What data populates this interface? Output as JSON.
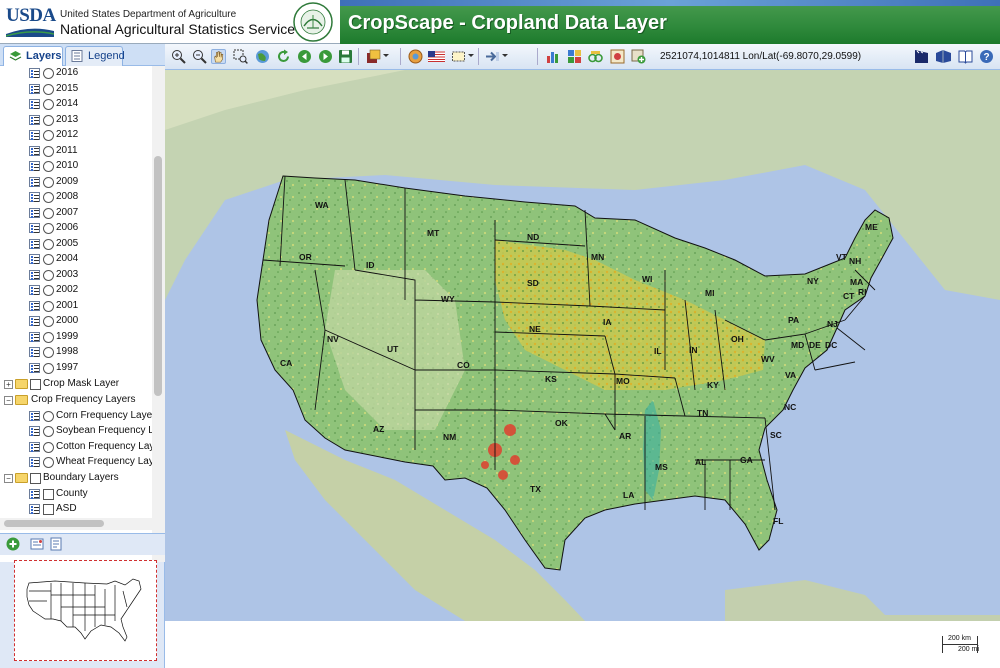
{
  "header": {
    "logo_text": "USDA",
    "department": "United States Department of Agriculture",
    "agency": "National Agricultural Statistics Service",
    "seal_text": "AGRICULTURE COUNTS",
    "app_title": "CropScape - Cropland Data Layer"
  },
  "panel": {
    "tabs": [
      {
        "label": "Layers",
        "active": true,
        "icon": "layers-icon"
      },
      {
        "label": "Legend",
        "active": false,
        "icon": "legend-icon"
      }
    ],
    "years": [
      "2016",
      "2015",
      "2014",
      "2013",
      "2012",
      "2011",
      "2010",
      "2009",
      "2008",
      "2007",
      "2006",
      "2005",
      "2004",
      "2003",
      "2002",
      "2001",
      "2000",
      "1999",
      "1998",
      "1997"
    ],
    "crop_mask": "Crop Mask Layer",
    "crop_frequency": {
      "label": "Crop Frequency Layers",
      "items": [
        "Corn Frequency Layer (",
        "Soybean Frequency Lay",
        "Cotton Frequency Lay",
        "Wheat Frequency Layer"
      ]
    },
    "boundary": {
      "label": "Boundary Layers",
      "items": [
        "County",
        "ASD"
      ]
    },
    "bottom_tools": [
      "add-layer-icon",
      "layer-properties-icon",
      "layer-info-icon"
    ]
  },
  "toolbar": {
    "tools": [
      "zoom-in-icon",
      "zoom-out-icon",
      "pan-icon",
      "zoom-box-icon",
      "full-extent-icon",
      "refresh-icon",
      "back-icon",
      "forward-icon",
      "save-icon",
      "export-icon",
      "identify-icon",
      "us-flag-icon",
      "select-area-icon",
      "define-aoi-icon",
      "statistics-icon",
      "analysis-icon",
      "change-icon",
      "crop-freq-icon",
      "add-data-icon"
    ],
    "coordinates": "2521074,1014811 Lon/Lat(-69.8070,29.0599)",
    "right_tools": [
      "tutorial-icon",
      "layers-book-icon",
      "help-book-icon",
      "help-icon"
    ],
    "colors": {
      "accent": "#15428b",
      "header_green": "#2f8a3c"
    }
  },
  "map": {
    "states": [
      "WA",
      "OR",
      "CA",
      "ID",
      "NV",
      "MT",
      "WY",
      "UT",
      "AZ",
      "CO",
      "NM",
      "ND",
      "SD",
      "NE",
      "KS",
      "OK",
      "TX",
      "MN",
      "IA",
      "MO",
      "AR",
      "LA",
      "WI",
      "IL",
      "MI",
      "IN",
      "OH",
      "KY",
      "TN",
      "MS",
      "AL",
      "GA",
      "FL",
      "SC",
      "NC",
      "VA",
      "WV",
      "PA",
      "NY",
      "VT",
      "NH",
      "ME",
      "MA",
      "CT",
      "RI",
      "NJ",
      "MD",
      "DE",
      "DC"
    ],
    "scale_km": "200 km",
    "scale_mi": "200 mi"
  }
}
